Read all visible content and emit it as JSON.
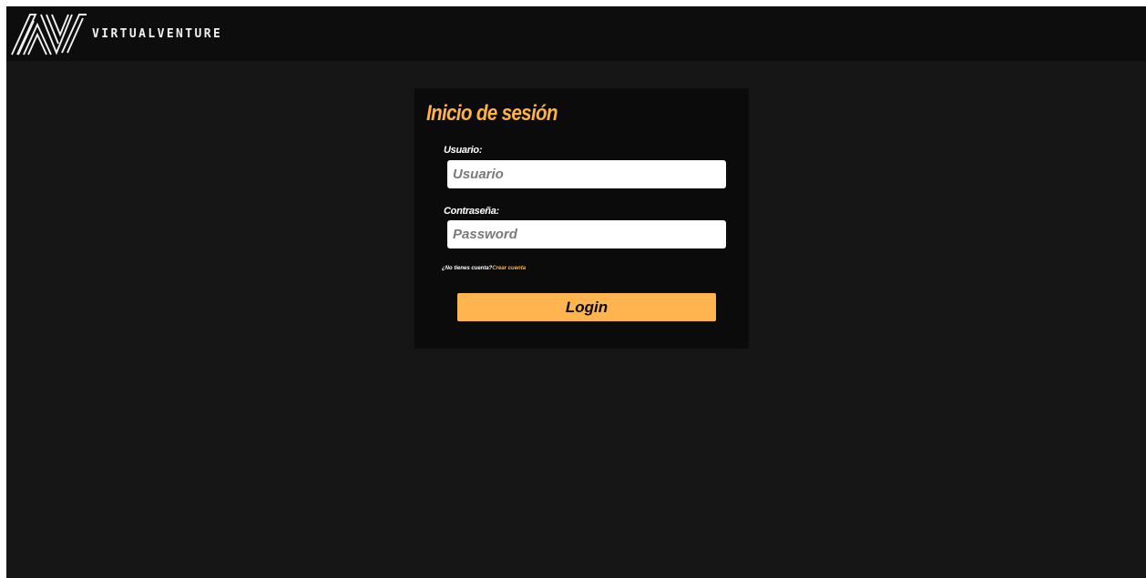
{
  "header": {
    "brand_name": "VIRTUALVENTURE",
    "logo_icon": "av-monogram-logo",
    "logo_text": "AV"
  },
  "login_card": {
    "title": "Inicio de sesión",
    "username": {
      "label": "Usuario:",
      "placeholder": "Usuario",
      "value": ""
    },
    "password": {
      "label": "Contraseña:",
      "placeholder": "Password",
      "value": ""
    },
    "register_prompt": "¿No tienes cuenta?",
    "register_link": "Crear cuenta",
    "submit_label": "Login"
  },
  "colors": {
    "page_background": "#161616",
    "topbar_background": "#0d0d0d",
    "card_background": "#0b0b0b",
    "accent": "#ffb347",
    "button_background": "#ffb54f",
    "text_light": "#ffffff"
  }
}
